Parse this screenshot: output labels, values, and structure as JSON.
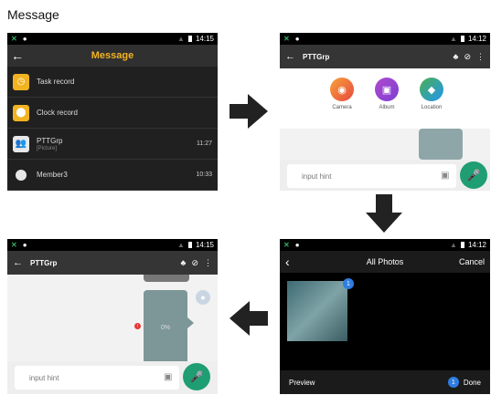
{
  "page": {
    "title": "Message"
  },
  "status": {
    "time_a": "14:15",
    "time_b": "14:12"
  },
  "screen1": {
    "title": "Message",
    "items": [
      {
        "label": "Task record",
        "icon": "clock-icon"
      },
      {
        "label": "Clock record",
        "icon": "location-icon"
      },
      {
        "label": "PTTGrp",
        "sub": "[Picture]",
        "time": "11:27",
        "icon": "group-icon"
      },
      {
        "label": "Member3",
        "time": "10:33",
        "icon": "avatar-icon"
      }
    ]
  },
  "chat": {
    "title": "PTTGrp",
    "input_hint": "input hint",
    "attach": [
      {
        "label": "Camera",
        "icon": "camera-icon"
      },
      {
        "label": "Album",
        "icon": "album-icon"
      },
      {
        "label": "Location",
        "icon": "location-icon"
      }
    ],
    "upload_progress": "0%"
  },
  "gallery": {
    "title": "All Photos",
    "cancel": "Cancel",
    "preview": "Preview",
    "done": "Done",
    "selected_count": "1",
    "photo_badge": "1"
  },
  "colors": {
    "accent_yellow": "#f2b321",
    "mic_green": "#1e9e72",
    "select_blue": "#2f7de1",
    "dark_bar": "#353535"
  }
}
